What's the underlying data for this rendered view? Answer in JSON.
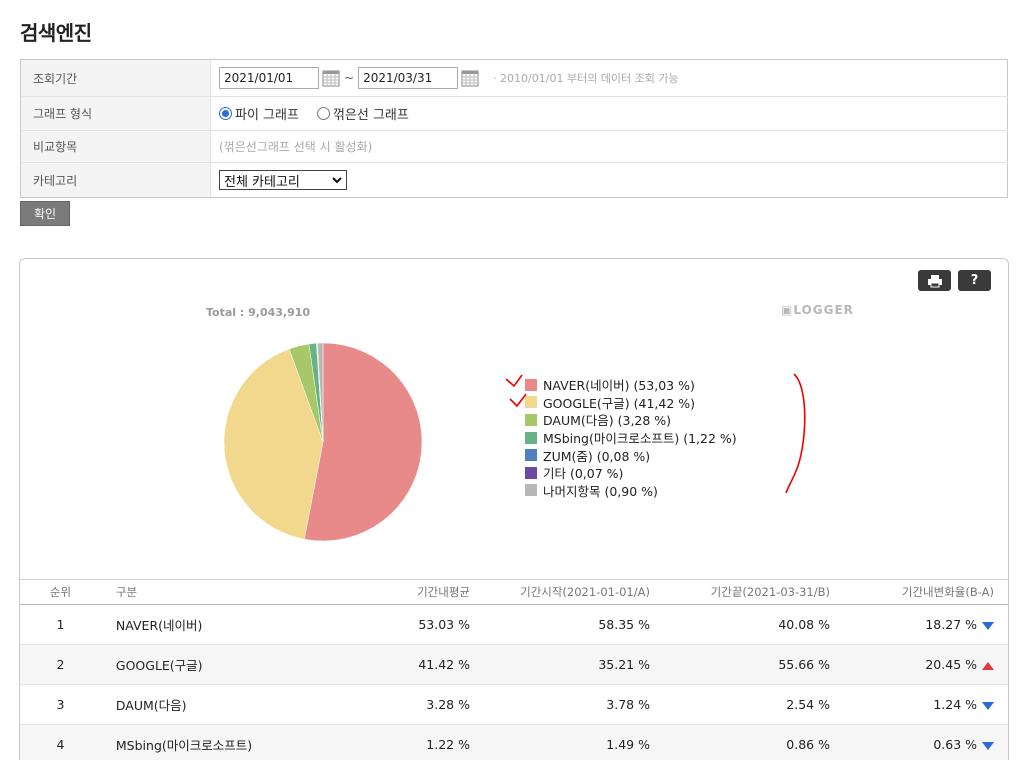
{
  "page": {
    "title": "검색엔진"
  },
  "filters": {
    "period": {
      "label": "조회기간",
      "start": "2021/01/01",
      "end": "2021/03/31",
      "tilde": "~",
      "note": "· 2010/01/01 부터의 데이터 조회 가능"
    },
    "graph_type": {
      "label": "그래프 형식",
      "options": [
        "파이 그래프",
        "꺾은선 그래프"
      ],
      "selected": "파이 그래프"
    },
    "compare": {
      "label": "비교항목",
      "text": "(꺾은선그래프 선택 시 활성화)"
    },
    "category": {
      "label": "카테고리",
      "value": "전체 카테고리"
    },
    "confirm_label": "확인"
  },
  "chart": {
    "total": "Total : 9,043,910",
    "logo": "LOGGER",
    "help_label": "?",
    "icons": {
      "print": "print-icon",
      "help": "help-icon"
    }
  },
  "chart_data": {
    "type": "pie",
    "title": "",
    "categories": [
      "NAVER(네이버)",
      "GOOGLE(구글)",
      "DAUM(다음)",
      "MSbing(마이크로소프트)",
      "ZUM(줌)",
      "기타",
      "나머지항목"
    ],
    "values": [
      53.03,
      41.42,
      3.28,
      1.22,
      0.08,
      0.07,
      0.9
    ],
    "legend_labels": [
      "NAVER(네이버)  (53,03 %)",
      "GOOGLE(구글)  (41,42 %)",
      "DAUM(다음)  (3,28 %)",
      "MSbing(마이크로소프트)  (1,22 %)",
      "ZUM(줌)  (0,08 %)",
      "기타  (0,07 %)",
      "나머지항목  (0,90 %)"
    ],
    "colors": [
      "#e98a8a",
      "#f1d88c",
      "#a7c768",
      "#68b383",
      "#4f7fc1",
      "#6e49a3",
      "#b8b8b8"
    ],
    "legend": "right"
  },
  "table": {
    "headers": [
      "순위",
      "구분",
      "기간내평균",
      "기간시작(2021-01-01/A)",
      "기간끝(2021-03-31/B)",
      "기간내변화율(B-A)"
    ],
    "rows": [
      {
        "rank": "1",
        "name": "NAVER(네이버)",
        "avg": "53.03 %",
        "start": "58.35 %",
        "end": "40.08 %",
        "change": "18.27 %",
        "direction": "down"
      },
      {
        "rank": "2",
        "name": "GOOGLE(구글)",
        "avg": "41.42 %",
        "start": "35.21 %",
        "end": "55.66 %",
        "change": "20.45 %",
        "direction": "up"
      },
      {
        "rank": "3",
        "name": "DAUM(다음)",
        "avg": "3.28 %",
        "start": "3.78 %",
        "end": "2.54 %",
        "change": "1.24 %",
        "direction": "down"
      },
      {
        "rank": "4",
        "name": "MSbing(마이크로소프트)",
        "avg": "1.22 %",
        "start": "1.49 %",
        "end": "0.86 %",
        "change": "0.63 %",
        "direction": "down"
      }
    ]
  }
}
